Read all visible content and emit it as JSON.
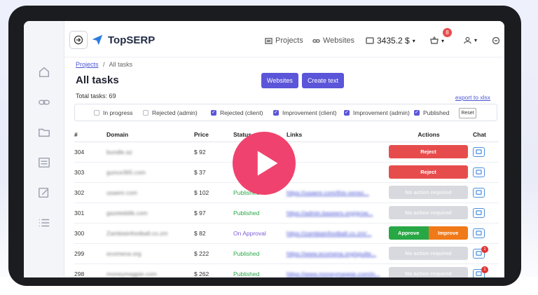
{
  "app": {
    "name": "TopSERP"
  },
  "header": {
    "nav": [
      {
        "label": "Projects",
        "icon": "projects-icon"
      },
      {
        "label": "Websites",
        "icon": "link-icon"
      }
    ],
    "balance": "3435.2 $",
    "cart_badge": "8"
  },
  "breadcrumb": {
    "root": "Projects",
    "sep": "/",
    "current": "All tasks"
  },
  "page": {
    "title": "All tasks",
    "total": "Total tasks: 69"
  },
  "buttons": {
    "websites": "Websites",
    "create_text": "Create text",
    "export": "export to xlsx",
    "reset": "Reset"
  },
  "filters": [
    {
      "label": "In progress",
      "checked": false
    },
    {
      "label": "Rejected (admin)",
      "checked": false
    },
    {
      "label": "Rejected (client)",
      "checked": true
    },
    {
      "label": "Improvement (client)",
      "checked": true
    },
    {
      "label": "Improvement (admin)",
      "checked": true
    },
    {
      "label": "Published",
      "checked": true
    }
  ],
  "table": {
    "headers": [
      "#",
      "Domain",
      "Price",
      "Status",
      "Links",
      "Actions",
      "Chat"
    ],
    "rows": [
      {
        "id": "304",
        "domain": "bundle.az",
        "price": "$ 92",
        "status": "",
        "link": "",
        "action": "Reject"
      },
      {
        "id": "303",
        "domain": "gunce365.com",
        "price": "$ 37",
        "status": "",
        "link": "",
        "action": "Reject"
      },
      {
        "id": "302",
        "domain": "usaenr.com",
        "price": "$ 102",
        "status": "Published",
        "link": "https://usaenr.com/this-venez...",
        "action": "No action required"
      },
      {
        "id": "301",
        "domain": "gazetebilik.com",
        "price": "$ 97",
        "status": "Published",
        "link": "https://admin.baseers.org/grow...",
        "action": "No action required"
      },
      {
        "id": "300",
        "domain": "Zambiainfootball.co.zm",
        "price": "$ 82",
        "status": "On Approval",
        "link": "https://zambiainfootball.co.zm/...",
        "action_approve": "Approve",
        "action_improve": "Improve"
      },
      {
        "id": "299",
        "domain": "ecomena.org",
        "price": "$ 222",
        "status": "Published",
        "link": "https://www.ecomena.org/sputte...",
        "action": "No action required",
        "chat_badge": "1"
      },
      {
        "id": "298",
        "domain": "moneymagpie.com",
        "price": "$ 262",
        "status": "Published",
        "link": "https://www.moneymagpie.com/in...",
        "action": "No action required",
        "chat_badge": "1"
      }
    ]
  },
  "colors": {
    "accent": "#5b55d9",
    "reject": "#e74c4c",
    "approve": "#28a745",
    "improve": "#f07a1a",
    "published": "#28a745",
    "approval": "#7b5cd6",
    "play": "#f0426e"
  },
  "overlay": {
    "icon": "play-icon"
  }
}
